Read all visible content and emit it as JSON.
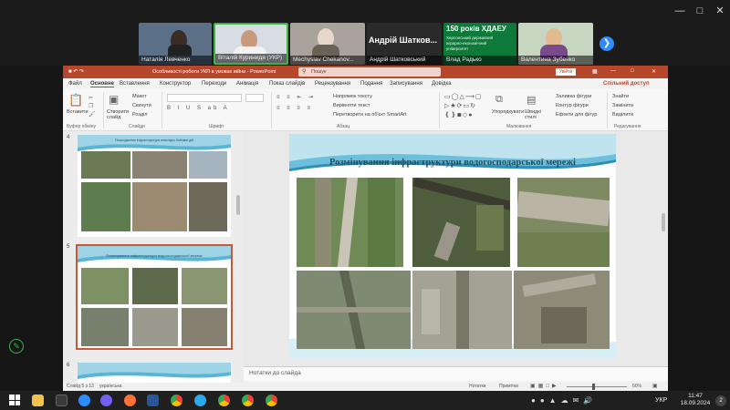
{
  "meeting": {
    "participants": [
      {
        "name": "Наталія Левченко"
      },
      {
        "name": "Віталій Куринидя (УКР)"
      },
      {
        "name": "Mechyslav Chekanov..."
      },
      {
        "name": "Андрій Шатковський"
      },
      {
        "name": "Влад Радько"
      },
      {
        "name": "Валентина Зубенко"
      }
    ],
    "featured_name": "Андрій Шатков...",
    "banner_title": "150 років ХДАЕУ",
    "banner_lines": [
      "Херсонський державний",
      "аграрно-економічний",
      "університет"
    ]
  },
  "ppt": {
    "title": "Особливості роботи УКП в умовах війни - PowerPoint",
    "search": "Пошук",
    "user": "Увійти",
    "menu": [
      "Файл",
      "Основне",
      "Вставлення",
      "Конструктор",
      "Переходи",
      "Анімація",
      "Показ слайдів",
      "Рецензування",
      "Подання",
      "Записування",
      "Довідка"
    ],
    "share": "Спільний доступ",
    "ribbon": {
      "paste": "Вставити",
      "clipboard": "Буфер обміну",
      "new_slide": "Створити слайд",
      "layout": "Макет",
      "reset": "Скинути",
      "section": "Розділ",
      "slides": "Слайди",
      "font": "Шрифт",
      "paragraph": "Абзац",
      "text_dir": "Напрямок тексту",
      "align_text": "Вирівняти текст",
      "smartart": "Перетворити на об'єкт SmartArt",
      "arrange": "Упорядкувати",
      "quick_styles": "Швидкі стилі",
      "shape_fill": "Заливка фігури",
      "shape_outline": "Контур фігури",
      "shape_effects": "Ефекти для фігур",
      "drawing": "Малювання",
      "find": "Знайти",
      "replace": "Замінити",
      "select": "Виділити",
      "editing": "Редагування"
    },
    "slides": [
      {
        "number": "4",
        "title": "Пошкодження інфраструктури внаслідок бойових дій"
      },
      {
        "number": "5",
        "title": "Розмінування інфраструктури водогосподарської мережі"
      },
      {
        "number": "6",
        "title": ""
      }
    ],
    "current_slide_title": "Розмінування інфраструктури водогосподарської мережі",
    "notes_placeholder": "Нотатки до слайда",
    "status": {
      "slide_info": "Слайд 5 з 13",
      "language": "українська",
      "notes_btn": "Нотатки",
      "comments_btn": "Примітки",
      "zoom": "60%"
    }
  },
  "taskbar": {
    "time": "11:47",
    "date": "18.09.2024",
    "lang": "УКР",
    "notif_count": "2"
  },
  "colors": {
    "ppt_accent": "#b7472a",
    "zoom_blue": "#2d8cff",
    "slide_title": "#1f4e5f"
  }
}
